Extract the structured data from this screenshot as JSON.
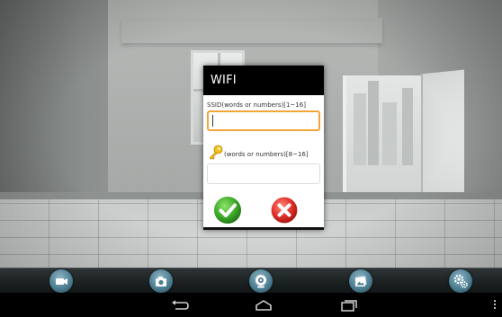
{
  "dialog": {
    "title": "WIFI",
    "ssid_label": "SSID(words or numbers)[1~16]",
    "ssid_value": "",
    "password_label": "(words or numbers)[8~16]",
    "password_value": "",
    "confirm_icon": "check-icon",
    "cancel_icon": "close-icon"
  },
  "toolbar": {
    "buttons": [
      "video-record-icon",
      "camera-snapshot-icon",
      "webcam-icon",
      "photo-gallery-icon",
      "settings-gears-icon"
    ]
  },
  "navbar": {
    "buttons": [
      "back-icon",
      "home-icon",
      "recent-apps-icon",
      "overflow-menu-icon"
    ]
  },
  "colors": {
    "dialog_title_bg": "#000000",
    "ssid_focus_border": "#f2a63a",
    "confirm_green": "#3fae2a",
    "cancel_red": "#e0302a",
    "toolbar_button": "#4d7f93"
  }
}
